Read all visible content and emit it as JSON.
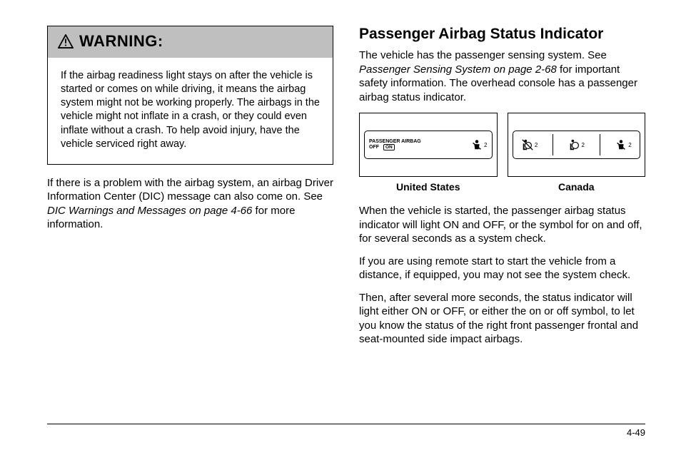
{
  "warning": {
    "title": "WARNING:",
    "body": "If the airbag readiness light stays on after the vehicle is started or comes on while driving, it means the airbag system might not be working properly. The airbags in the vehicle might not inflate in a crash, or they could even inflate without a crash. To help avoid injury, have the vehicle serviced right away."
  },
  "left": {
    "p1_a": "If there is a problem with the airbag system, an airbag Driver Information Center (DIC) message can also come on. See ",
    "p1_ref": "DIC Warnings and Messages on page 4-66",
    "p1_b": " for more information."
  },
  "right": {
    "title": "Passenger Airbag Status Indicator",
    "p1_a": "The vehicle has the passenger sensing system. See ",
    "p1_ref": "Passenger Sensing System on page 2-68",
    "p1_b": " for important safety information. The overhead console has a passenger airbag status indicator.",
    "ind_text_line1": "PASSENGER AIRBAG",
    "ind_text_off": "OFF",
    "ind_text_on": "ON",
    "ind_sub": "2",
    "caption_us": "United States",
    "caption_ca": "Canada",
    "p2": "When the vehicle is started, the passenger airbag status indicator will light ON and OFF, or the symbol for on and off, for several seconds as a system check.",
    "p3": "If you are using remote start to start the vehicle from a distance, if equipped, you may not see the system check.",
    "p4": "Then, after several more seconds, the status indicator will light either ON or OFF, or either the on or off symbol, to let you know the status of the right front passenger frontal and seat-mounted side impact airbags."
  },
  "page_number": "4-49"
}
